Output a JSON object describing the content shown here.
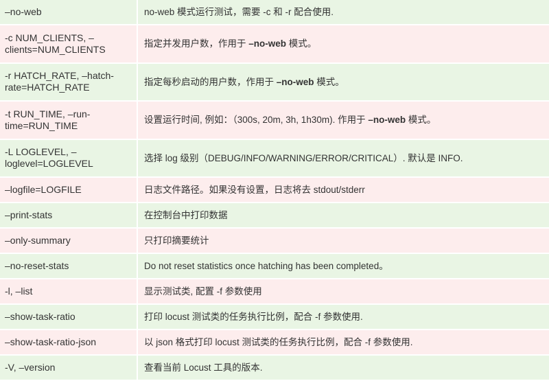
{
  "rows": [
    {
      "option": "–no-web",
      "desc_before": "no-web 模式运行测试，需要 -c 和 -r 配合使用.",
      "desc_bold": "",
      "desc_after": ""
    },
    {
      "option": "-c NUM_CLIENTS, –clients=NUM_CLIENTS",
      "desc_before": "指定并发用户数，作用于 ",
      "desc_bold": "–no-web",
      "desc_after": " 模式。"
    },
    {
      "option": "-r HATCH_RATE, –hatch-rate=HATCH_RATE",
      "desc_before": "指定每秒启动的用户数，作用于 ",
      "desc_bold": "–no-web",
      "desc_after": " 模式。"
    },
    {
      "option": "-t RUN_TIME, –run-time=RUN_TIME",
      "desc_before": "设置运行时间, 例如：（300s, 20m, 3h, 1h30m). 作用于 ",
      "desc_bold": "–no-web",
      "desc_after": " 模式。"
    },
    {
      "option": "-L LOGLEVEL, –loglevel=LOGLEVEL",
      "desc_before": "选择 log 级别（DEBUG/INFO/WARNING/ERROR/CRITICAL）. 默认是 INFO.",
      "desc_bold": "",
      "desc_after": ""
    },
    {
      "option": "–logfile=LOGFILE",
      "desc_before": "日志文件路径。如果没有设置，日志将去 stdout/stderr",
      "desc_bold": "",
      "desc_after": ""
    },
    {
      "option": "–print-stats",
      "desc_before": "在控制台中打印数据",
      "desc_bold": "",
      "desc_after": ""
    },
    {
      "option": "–only-summary",
      "desc_before": "只打印摘要统计",
      "desc_bold": "",
      "desc_after": ""
    },
    {
      "option": "–no-reset-stats",
      "desc_before": "Do not reset statistics once hatching has been completed。",
      "desc_bold": "",
      "desc_after": ""
    },
    {
      "option": "-l, –list",
      "desc_before": "显示测试类, 配置 -f 参数使用",
      "desc_bold": "",
      "desc_after": ""
    },
    {
      "option": "–show-task-ratio",
      "desc_before": "打印 locust 测试类的任务执行比例，配合 -f 参数使用.",
      "desc_bold": "",
      "desc_after": ""
    },
    {
      "option": "–show-task-ratio-json",
      "desc_before": "以 json 格式打印 locust 测试类的任务执行比例，配合 -f 参数使用.",
      "desc_bold": "",
      "desc_after": ""
    },
    {
      "option": "-V, –version",
      "desc_before": "查看当前 Locust 工具的版本.",
      "desc_bold": "",
      "desc_after": ""
    }
  ],
  "colors": {
    "row_green": "#e9f5e4",
    "row_pink": "#fdeded",
    "text": "#333333"
  }
}
